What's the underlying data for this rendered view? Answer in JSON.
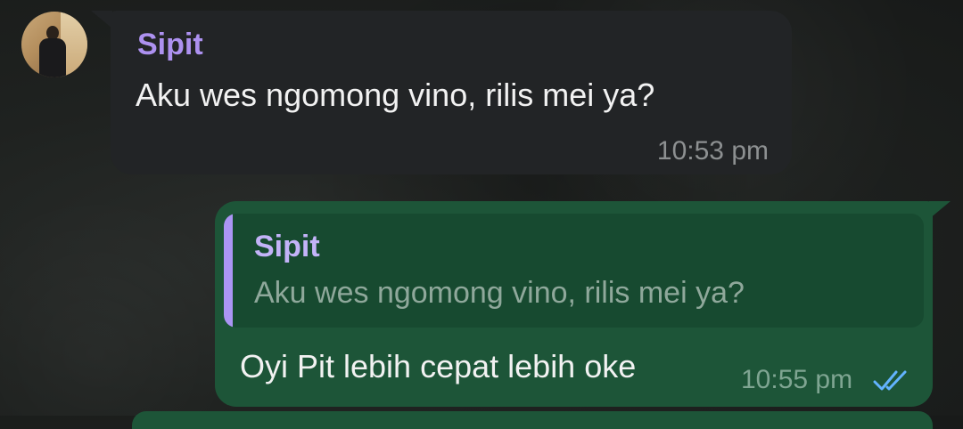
{
  "chat": {
    "incoming": {
      "sender": "Sipit",
      "text": "Aku wes ngomong vino, rilis mei ya?",
      "time": "10:53 pm",
      "avatar_icon": "avatar-photo"
    },
    "outgoing": {
      "quote_sender": "Sipit",
      "quote_text": "Aku wes ngomong vino, rilis mei ya?",
      "text": "Oyi Pit lebih cepat lebih oke",
      "time": "10:55 pm",
      "status_icon": "double-check-icon"
    }
  },
  "colors": {
    "incoming_bubble": "#222426",
    "outgoing_bubble": "#1d5538",
    "quote_background": "#174a30",
    "sender_name": "#ad91f0",
    "quote_bar": "#ab95f4",
    "read_ticks": "#63b3ff"
  }
}
